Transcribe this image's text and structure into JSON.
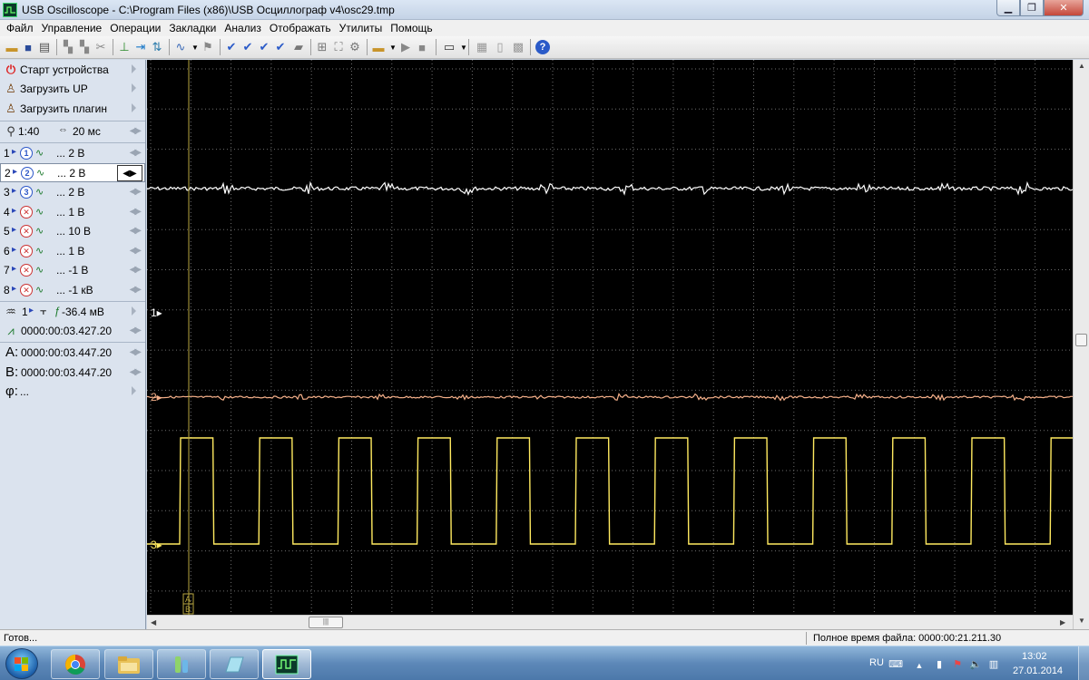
{
  "window": {
    "title": "USB Oscilloscope - C:\\Program Files (x86)\\USB Осциллограф v4\\osc29.tmp",
    "app_icon": "oscilloscope-icon"
  },
  "menu": [
    "Файл",
    "Управление",
    "Операции",
    "Закладки",
    "Анализ",
    "Отображать",
    "Утилиты",
    "Помощь"
  ],
  "left_panel": {
    "start_device": "Старт устройства",
    "load_up": "Загрузить UP",
    "load_plugin": "Загрузить плагин",
    "zoom": "1:40",
    "timebase": "20 мс",
    "channels": [
      {
        "num": "1",
        "circle": "1",
        "scale": "... 2 В",
        "enabled": true
      },
      {
        "num": "2",
        "circle": "2",
        "scale": "... 2 В",
        "enabled": true
      },
      {
        "num": "3",
        "circle": "3",
        "scale": "... 2 В",
        "enabled": true
      },
      {
        "num": "4",
        "circle": "",
        "scale": "... 1 В",
        "enabled": false
      },
      {
        "num": "5",
        "circle": "",
        "scale": "... 10 В",
        "enabled": false
      },
      {
        "num": "6",
        "circle": "",
        "scale": "... 1 В",
        "enabled": false
      },
      {
        "num": "7",
        "circle": "",
        "scale": "... -1 В",
        "enabled": false
      },
      {
        "num": "8",
        "circle": "",
        "scale": "... -1 кВ",
        "enabled": false
      }
    ],
    "trigger_channel": "1",
    "trigger_level": "-36.4 мВ",
    "trigger_time": "0000:00:03.427.20",
    "cursor_a_label": "A:",
    "cursor_a": "0000:00:03.447.20",
    "cursor_b_label": "B:",
    "cursor_b": "0000:00:03.447.20",
    "phi_label": "φ:",
    "phi": "..."
  },
  "scope": {
    "background": "#000000",
    "grid_color": "#6e6e6e",
    "cursor_color": "#b8a640",
    "cursor_label": "AB",
    "traces": [
      {
        "marker": "1",
        "color": "#ffffff",
        "kind": "noise"
      },
      {
        "marker": "2",
        "color": "#f5b08a",
        "kind": "noise"
      },
      {
        "marker": "3",
        "color": "#ffea60",
        "kind": "square"
      }
    ]
  },
  "status": {
    "left": "Готов...",
    "right": "Полное время файла: 0000:00:21.211.30"
  },
  "taskbar": {
    "apps": [
      "chrome-icon",
      "explorer-icon",
      "chemistry-app-icon",
      "notes-app-icon",
      "oscilloscope-app-icon"
    ],
    "lang": "RU",
    "time": "13:02",
    "date": "27.01.2014"
  }
}
